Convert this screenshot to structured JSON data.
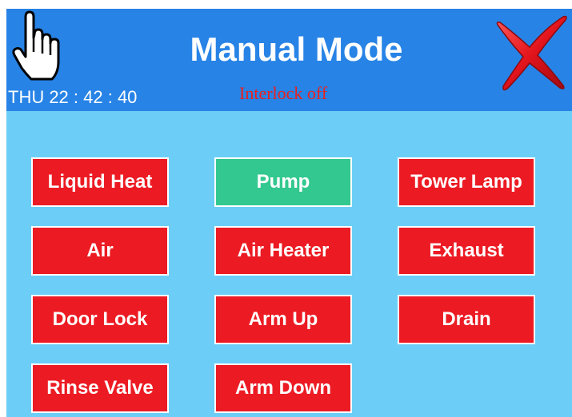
{
  "header": {
    "title": "Manual Mode",
    "clock": "THU 22 : 42 : 40",
    "interlock_status": "Interlock off",
    "left_icon": "hand-pointer-icon",
    "right_icon": "close-x-icon"
  },
  "colors": {
    "header_bg": "#2783e6",
    "panel_bg": "#6ccef6",
    "button_off": "#ec1b23",
    "button_on": "#33c88f",
    "interlock_text": "#e8211f"
  },
  "buttons": [
    {
      "label": "Liquid Heat",
      "state": "off"
    },
    {
      "label": "Pump",
      "state": "on"
    },
    {
      "label": "Tower Lamp",
      "state": "off"
    },
    {
      "label": "Air",
      "state": "off"
    },
    {
      "label": "Air Heater",
      "state": "off"
    },
    {
      "label": "Exhaust",
      "state": "off"
    },
    {
      "label": "Door Lock",
      "state": "off"
    },
    {
      "label": "Arm Up",
      "state": "off"
    },
    {
      "label": "Drain",
      "state": "off"
    },
    {
      "label": "Rinse Valve",
      "state": "off"
    },
    {
      "label": "Arm Down",
      "state": "off"
    }
  ]
}
